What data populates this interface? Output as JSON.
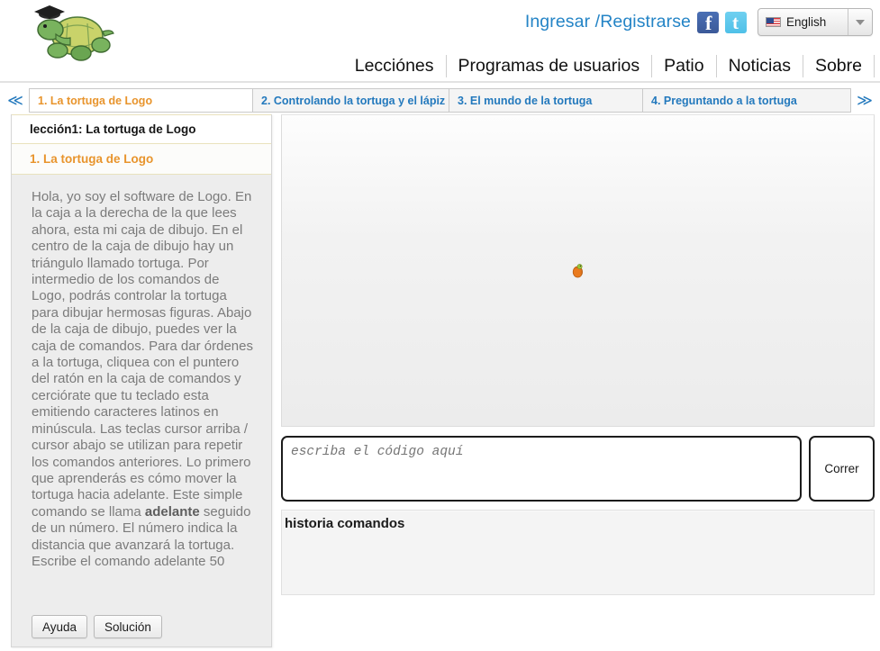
{
  "header": {
    "logo_alt": "Turtle Academy logo - green turtle with graduation cap",
    "login_label": "Ingresar /Registrarse",
    "facebook_label": "Facebook",
    "twitter_label": "Twitter",
    "language": {
      "selected": "English",
      "flag": "us-flag-icon"
    },
    "nav": [
      {
        "label": "Lecciónes"
      },
      {
        "label": "Programas de usuarios"
      },
      {
        "label": "Patio"
      },
      {
        "label": "Noticias"
      },
      {
        "label": "Sobre"
      }
    ]
  },
  "tabstrip": {
    "prev_label": "≪",
    "next_label": "≫",
    "tabs": [
      {
        "label": "1. La tortuga de Logo",
        "active": true
      },
      {
        "label": "2. Controlando la tortuga y el lápiz",
        "active": false
      },
      {
        "label": "3. El mundo de la tortuga",
        "active": false
      },
      {
        "label": "4. Preguntando a la tortuga",
        "active": false
      }
    ]
  },
  "lesson": {
    "title": "lección1: La tortuga de Logo",
    "subtitle": "1. La tortuga de Logo",
    "paragraph_1": "Hola, yo soy el software de Logo. En la caja a la derecha de la que lees ahora, esta mi caja de dibujo. En el centro de la caja de dibujo hay un triángulo llamado tortuga. Por intermedio de los comandos de Logo, podrás controlar la tortuga para dibujar hermosas figuras. Abajo de la caja de dibujo, puedes ver la caja de comandos. Para dar órdenes a la tortuga, cliquea con el puntero del ratón en la caja de comandos y cerciórate que tu teclado esta emitiendo caracteres latinos en minúscula. Las teclas cursor arriba / cursor abajo se utilizan para repetir los comandos anteriores. Lo primero que aprenderás es cómo mover la tortuga hacia adelante. Este simple comando se llama ",
    "bold_command": "adelante",
    "paragraph_2": " seguido de un número. El número indica la distancia que avanzará la tortuga.",
    "instruction": "Escribe el comando adelante 50",
    "help_button": "Ayuda",
    "solution_button": "Solución"
  },
  "workspace": {
    "canvas_name": "drawing-canvas",
    "turtle_name": "turtle-sprite",
    "command_placeholder": "escriba el código aquí",
    "command_value": "",
    "run_button": "Correr",
    "history_title": "historia comandos",
    "history_entries": []
  },
  "colors": {
    "link_blue": "#2484c6",
    "tab_blue": "#2379bd",
    "active_orange": "#e8942c",
    "lesson_text_gray": "#7b7b7b",
    "panel_bg": "#ededed"
  }
}
